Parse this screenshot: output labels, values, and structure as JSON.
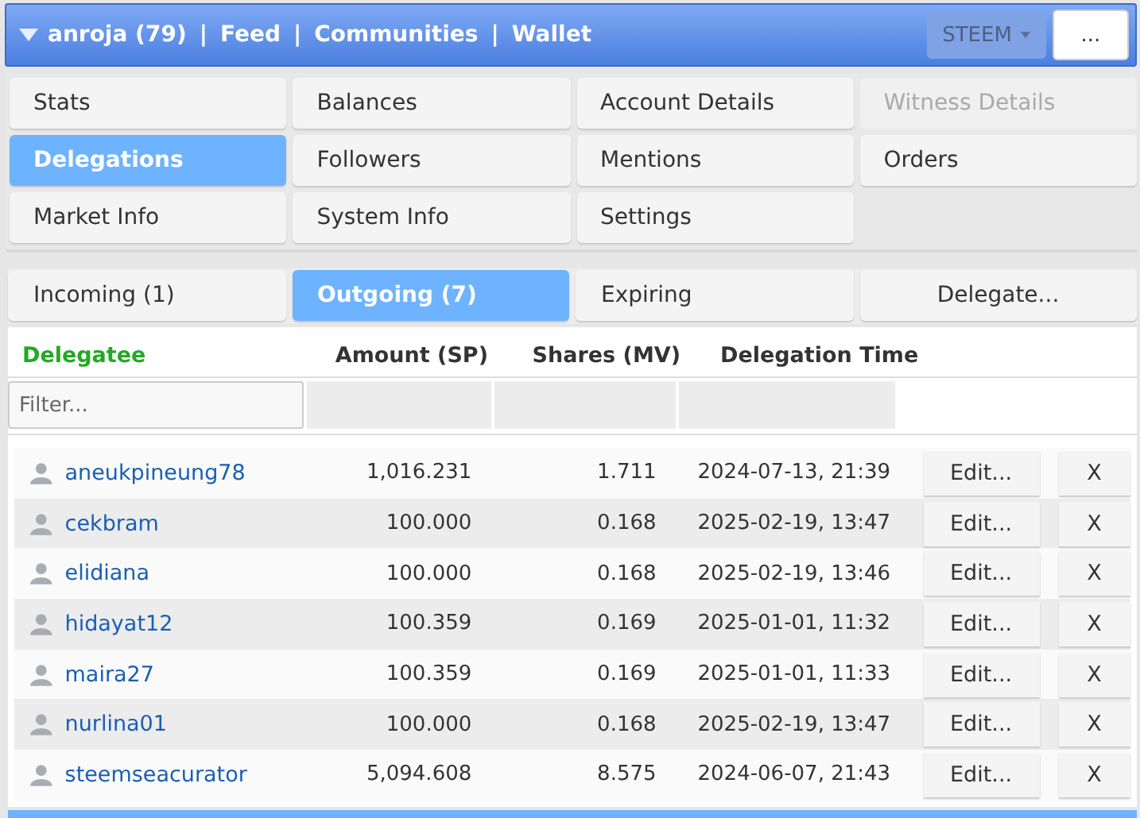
{
  "header": {
    "links": [
      {
        "kind": "link",
        "text": "anroja (79)"
      },
      {
        "kind": "separator",
        "text": "|"
      },
      {
        "kind": "link",
        "text": "Feed"
      },
      {
        "kind": "separator",
        "text": "|"
      },
      {
        "kind": "link",
        "text": "Communities"
      },
      {
        "kind": "separator",
        "text": "|"
      },
      {
        "kind": "link",
        "text": "Wallet"
      }
    ],
    "chain_select": "STEEM",
    "more_button": "..."
  },
  "menu": [
    {
      "label": "Stats",
      "selected": false,
      "disabled": false
    },
    {
      "label": "Balances",
      "selected": false,
      "disabled": false
    },
    {
      "label": "Account Details",
      "selected": false,
      "disabled": false
    },
    {
      "label": "Witness Details",
      "selected": false,
      "disabled": true
    },
    {
      "label": "Delegations",
      "selected": true,
      "disabled": false
    },
    {
      "label": "Followers",
      "selected": false,
      "disabled": false
    },
    {
      "label": "Mentions",
      "selected": false,
      "disabled": false
    },
    {
      "label": "Orders",
      "selected": false,
      "disabled": false
    },
    {
      "label": "Market Info",
      "selected": false,
      "disabled": false
    },
    {
      "label": "System Info",
      "selected": false,
      "disabled": false
    },
    {
      "label": "Settings",
      "selected": false,
      "disabled": false
    }
  ],
  "subtabs": [
    {
      "label": "Incoming (1)",
      "selected": false
    },
    {
      "label": "Outgoing (7)",
      "selected": true
    },
    {
      "label": "Expiring",
      "selected": false
    }
  ],
  "delegate_button": "Delegate...",
  "table": {
    "columns": [
      {
        "label": "Delegatee",
        "sorted": true
      },
      {
        "label": "Amount (SP)",
        "sorted": false
      },
      {
        "label": "Shares (MV)",
        "sorted": false
      },
      {
        "label": "Delegation Time",
        "sorted": false
      }
    ],
    "filter_placeholder": "Filter...",
    "rows": [
      {
        "delegatee": "aneukpineung78",
        "amount": "1,016.231",
        "shares": "1.711",
        "time": "2024-07-13, 21:39",
        "edit": "Edit...",
        "remove": "X"
      },
      {
        "delegatee": "cekbram",
        "amount": "100.000",
        "shares": "0.168",
        "time": "2025-02-19, 13:47",
        "edit": "Edit...",
        "remove": "X"
      },
      {
        "delegatee": "elidiana",
        "amount": "100.000",
        "shares": "0.168",
        "time": "2025-02-19, 13:46",
        "edit": "Edit...",
        "remove": "X"
      },
      {
        "delegatee": "hidayat12",
        "amount": "100.359",
        "shares": "0.169",
        "time": "2025-01-01, 11:32",
        "edit": "Edit...",
        "remove": "X"
      },
      {
        "delegatee": "maira27",
        "amount": "100.359",
        "shares": "0.169",
        "time": "2025-01-01, 11:33",
        "edit": "Edit...",
        "remove": "X"
      },
      {
        "delegatee": "nurlina01",
        "amount": "100.000",
        "shares": "0.168",
        "time": "2025-02-19, 13:47",
        "edit": "Edit...",
        "remove": "X"
      },
      {
        "delegatee": "steemseacurator",
        "amount": "5,094.608",
        "shares": "8.575",
        "time": "2024-06-07, 21:43",
        "edit": "Edit...",
        "remove": "X"
      }
    ]
  }
}
